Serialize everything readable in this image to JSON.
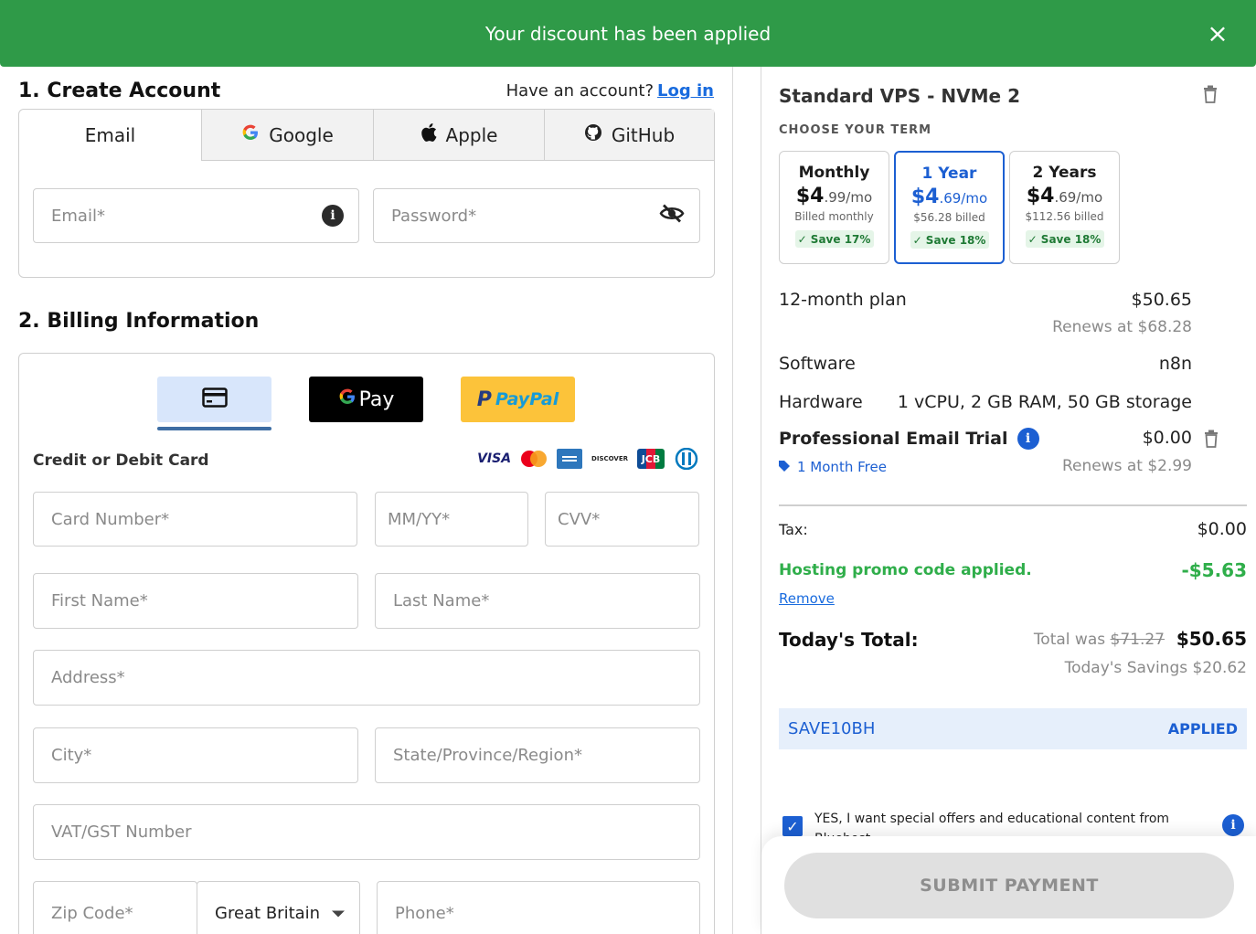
{
  "banner": {
    "message": "Your discount has been applied",
    "close_icon": "×"
  },
  "account": {
    "heading": "1. Create Account",
    "have_account": "Have an account?",
    "login_link": "Log in",
    "tabs": [
      {
        "label": "Email"
      },
      {
        "label": "Google",
        "icon": "G"
      },
      {
        "label": "Apple",
        "icon": ""
      },
      {
        "label": "GitHub",
        "icon": "◉"
      }
    ],
    "email_placeholder": "Email*",
    "password_placeholder": "Password*"
  },
  "billing": {
    "heading": "2. Billing Information",
    "gpay_label": "Pay",
    "paypal_label": "PayPal",
    "card_label": "Credit or Debit Card",
    "card_brands": [
      "VISA",
      "DISCOVER",
      "JCB"
    ],
    "card_number": "Card Number*",
    "expiry": "MM/YY*",
    "cvv": "CVV*",
    "first_name": "First Name*",
    "last_name": "Last Name*",
    "address": "Address*",
    "city": "City*",
    "state": "State/Province/Region*",
    "vat": "VAT/GST Number",
    "zip": "Zip Code*",
    "country": "Great Britain",
    "phone": "Phone*"
  },
  "summary": {
    "plan_title": "Standard VPS - NVMe 2",
    "term_label": "CHOOSE YOUR TERM",
    "terms": [
      {
        "name": "Monthly",
        "dollar": "$4",
        "cents": ".99/mo",
        "billed": "Billed monthly",
        "save": "✓ Save 17%"
      },
      {
        "name": "1 Year",
        "dollar": "$4",
        "cents": ".69/mo",
        "billed": "$56.28 billed",
        "save": "✓ Save 18%"
      },
      {
        "name": "2 Years",
        "dollar": "$4",
        "cents": ".69/mo",
        "billed": "$112.56 billed",
        "save": "✓ Save 18%"
      }
    ],
    "plan_line_label": "12-month plan",
    "plan_line_value": "$50.65",
    "plan_renews": "Renews at $68.28",
    "software_label": "Software",
    "software_value": "n8n",
    "hardware_label": "Hardware",
    "hardware_value": "1 vCPU, 2 GB RAM, 50 GB storage",
    "email_trial_label": "Professional Email Trial",
    "email_trial_value": "$0.00",
    "email_trial_tag": "1 Month Free",
    "email_trial_renews": "Renews at $2.99",
    "tax_label": "Tax:",
    "tax_value": "$0.00",
    "promo_label": "Hosting promo code applied.",
    "promo_value": "-$5.63",
    "remove_link": "Remove",
    "total_label": "Today's Total:",
    "total_was_prefix": "Total was",
    "total_was_value": "$71.27",
    "total_value": "$50.65",
    "savings": "Today's Savings $20.62",
    "coupon_code": "SAVE10BH",
    "coupon_status": "APPLIED",
    "optin_text": "YES, I want special offers and educational content from Bluehost",
    "submit_label": "SUBMIT PAYMENT"
  },
  "colors": {
    "banner": "#2f9a48",
    "accent": "#1c5fd2",
    "promo": "#2fae4a"
  }
}
